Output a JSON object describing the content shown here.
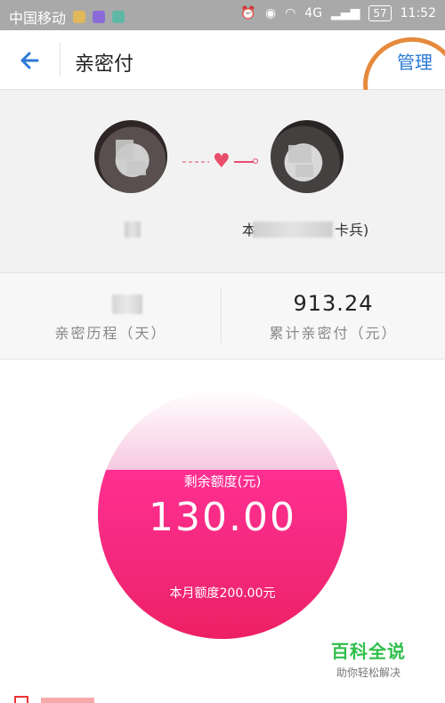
{
  "status_bar": {
    "carrier": "中国移动",
    "network": "4G",
    "battery": "57",
    "time": "11:52"
  },
  "header": {
    "title": "亲密付",
    "manage_label": "管理",
    "back_icon": "back-arrow-icon"
  },
  "couple": {
    "partner_name_prefix": "本",
    "partner_name_suffix": "卡兵)"
  },
  "stats": {
    "days_label": "亲密历程（天）",
    "total_value": "913.24",
    "total_label": "累计亲密付（元）"
  },
  "quota": {
    "remaining_label": "剩余额度(元)",
    "remaining_value": "130.00",
    "monthly_label": "本月额度200.00元",
    "fill_fraction": 0.68
  },
  "watermark": {
    "title": "百科全说",
    "subtitle": "助你轻松解决"
  },
  "colors": {
    "accent_blue": "#2a7ad6",
    "pink": "#ee2063",
    "annotation_orange": "#e58a3c"
  }
}
